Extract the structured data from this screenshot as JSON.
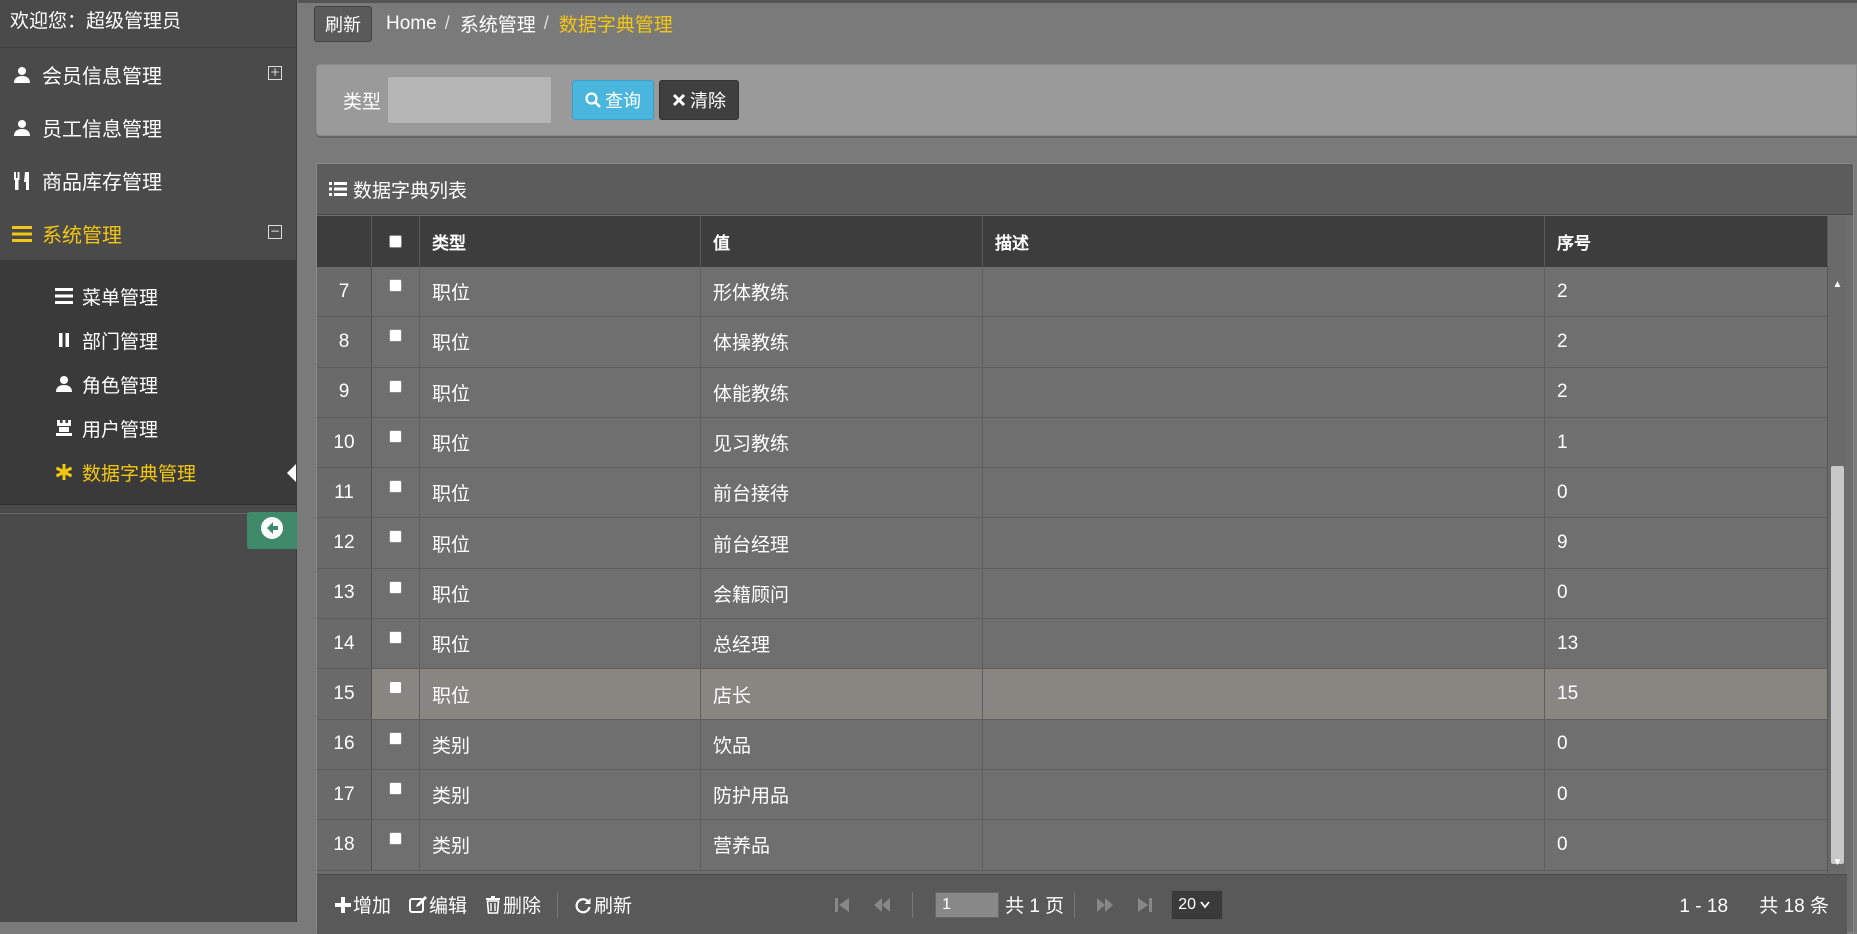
{
  "sidebar": {
    "welcome": "欢迎您：超级管理员",
    "items": [
      {
        "label": "会员信息管理",
        "icon": "user-icon",
        "toggle": "⊞"
      },
      {
        "label": "员工信息管理",
        "icon": "user-icon"
      },
      {
        "label": "商品库存管理",
        "icon": "cutlery-icon"
      },
      {
        "label": "系统管理",
        "icon": "list-icon",
        "toggle": "⊟"
      }
    ],
    "submenu": [
      {
        "label": "菜单管理",
        "icon": "list-icon"
      },
      {
        "label": "部门管理",
        "icon": "pause-icon"
      },
      {
        "label": "角色管理",
        "icon": "user-icon"
      },
      {
        "label": "用户管理",
        "icon": "tower-icon"
      },
      {
        "label": "数据字典管理",
        "icon": "asterisk-icon"
      }
    ]
  },
  "topbar": {
    "refresh": "刷新",
    "breadcrumb": [
      "Home",
      "系统管理",
      "数据字典管理"
    ],
    "separator": "/"
  },
  "search": {
    "label": "类型",
    "value": "",
    "query_button": "查询",
    "clear_button": "清除"
  },
  "grid": {
    "title": "数据字典列表",
    "columns": [
      "类型",
      "值",
      "描述",
      "序号"
    ],
    "rows": [
      {
        "num": "7",
        "type": "职位",
        "value": "形体教练",
        "desc": "",
        "order": "2"
      },
      {
        "num": "8",
        "type": "职位",
        "value": "体操教练",
        "desc": "",
        "order": "2"
      },
      {
        "num": "9",
        "type": "职位",
        "value": "体能教练",
        "desc": "",
        "order": "2"
      },
      {
        "num": "10",
        "type": "职位",
        "value": "见习教练",
        "desc": "",
        "order": "1"
      },
      {
        "num": "11",
        "type": "职位",
        "value": "前台接待",
        "desc": "",
        "order": "0"
      },
      {
        "num": "12",
        "type": "职位",
        "value": "前台经理",
        "desc": "",
        "order": "9"
      },
      {
        "num": "13",
        "type": "职位",
        "value": "会籍顾问",
        "desc": "",
        "order": "0"
      },
      {
        "num": "14",
        "type": "职位",
        "value": "总经理",
        "desc": "",
        "order": "13"
      },
      {
        "num": "15",
        "type": "职位",
        "value": "店长",
        "desc": "",
        "order": "15"
      },
      {
        "num": "16",
        "type": "类别",
        "value": "饮品",
        "desc": "",
        "order": "0"
      },
      {
        "num": "17",
        "type": "类别",
        "value": "防护用品",
        "desc": "",
        "order": "0"
      },
      {
        "num": "18",
        "type": "类别",
        "value": "营养品",
        "desc": "",
        "order": "0"
      }
    ],
    "selected_row": "15"
  },
  "pager": {
    "add": "增加",
    "edit": "编辑",
    "delete": "删除",
    "refresh": "刷新",
    "page": "1",
    "total_pages": "共 1 页",
    "page_size": "20",
    "range": "1 - 18",
    "total": "共 18 条"
  },
  "colors": {
    "accent": "#f3c613",
    "query_button": "#4ab6dd",
    "collapse_button": "#3e8a6a"
  }
}
